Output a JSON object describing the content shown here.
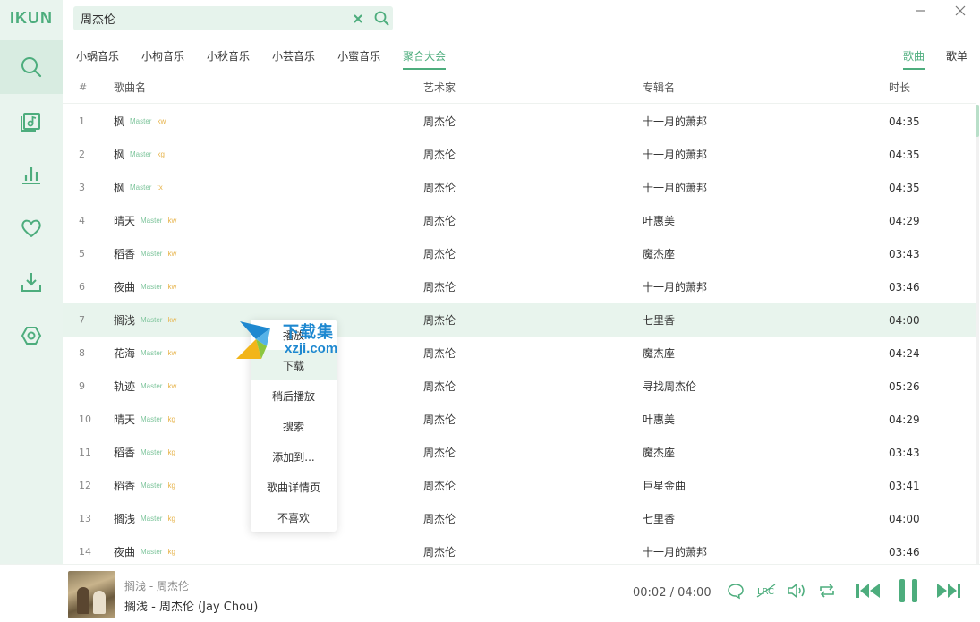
{
  "app": {
    "logo": "IKUN"
  },
  "search": {
    "value": "周杰伦"
  },
  "tabs": [
    {
      "label": "小蜗音乐",
      "active": false
    },
    {
      "label": "小枸音乐",
      "active": false
    },
    {
      "label": "小秋音乐",
      "active": false
    },
    {
      "label": "小芸音乐",
      "active": false
    },
    {
      "label": "小蜜音乐",
      "active": false
    },
    {
      "label": "聚合大会",
      "active": true
    }
  ],
  "type_tabs": [
    {
      "label": "歌曲",
      "active": true
    },
    {
      "label": "歌单",
      "active": false
    }
  ],
  "columns": {
    "idx": "#",
    "name": "歌曲名",
    "artist": "艺术家",
    "album": "专辑名",
    "duration": "时长"
  },
  "rows": [
    {
      "idx": "1",
      "name": "枫",
      "quality": "Master",
      "source": "kw",
      "artist": "周杰伦",
      "album": "十一月的萧邦",
      "duration": "04:35"
    },
    {
      "idx": "2",
      "name": "枫",
      "quality": "Master",
      "source": "kg",
      "artist": "周杰伦",
      "album": "十一月的萧邦",
      "duration": "04:35"
    },
    {
      "idx": "3",
      "name": "枫",
      "quality": "Master",
      "source": "tx",
      "artist": "周杰伦",
      "album": "十一月的萧邦",
      "duration": "04:35"
    },
    {
      "idx": "4",
      "name": "晴天",
      "quality": "Master",
      "source": "kw",
      "artist": "周杰伦",
      "album": "叶惠美",
      "duration": "04:29"
    },
    {
      "idx": "5",
      "name": "稻香",
      "quality": "Master",
      "source": "kw",
      "artist": "周杰伦",
      "album": "魔杰座",
      "duration": "03:43"
    },
    {
      "idx": "6",
      "name": "夜曲",
      "quality": "Master",
      "source": "kw",
      "artist": "周杰伦",
      "album": "十一月的萧邦",
      "duration": "03:46"
    },
    {
      "idx": "7",
      "name": "搁浅",
      "quality": "Master",
      "source": "kw",
      "artist": "周杰伦",
      "album": "七里香",
      "duration": "04:00"
    },
    {
      "idx": "8",
      "name": "花海",
      "quality": "Master",
      "source": "kw",
      "artist": "周杰伦",
      "album": "魔杰座",
      "duration": "04:24"
    },
    {
      "idx": "9",
      "name": "轨迹",
      "quality": "Master",
      "source": "kw",
      "artist": "周杰伦",
      "album": "寻找周杰伦",
      "duration": "05:26"
    },
    {
      "idx": "10",
      "name": "晴天",
      "quality": "Master",
      "source": "kg",
      "artist": "周杰伦",
      "album": "叶惠美",
      "duration": "04:29"
    },
    {
      "idx": "11",
      "name": "稻香",
      "quality": "Master",
      "source": "kg",
      "artist": "周杰伦",
      "album": "魔杰座",
      "duration": "03:43"
    },
    {
      "idx": "12",
      "name": "稻香",
      "quality": "Master",
      "source": "kg",
      "artist": "周杰伦",
      "album": "巨星金曲",
      "duration": "03:41"
    },
    {
      "idx": "13",
      "name": "搁浅",
      "quality": "Master",
      "source": "kg",
      "artist": "周杰伦",
      "album": "七里香",
      "duration": "04:00"
    },
    {
      "idx": "14",
      "name": "夜曲",
      "quality": "Master",
      "source": "kg",
      "artist": "周杰伦",
      "album": "十一月的萧邦",
      "duration": "03:46"
    }
  ],
  "highlighted_row": "7",
  "context_menu": [
    "播放",
    "下载",
    "稍后播放",
    "搜索",
    "添加到...",
    "歌曲详情页",
    "不喜欢"
  ],
  "watermark": {
    "text": "下载集",
    "sub": "xzji.com"
  },
  "player": {
    "subtitle": "搁浅 - 周杰伦",
    "title": "搁浅 - 周杰伦 (Jay Chou)",
    "current": "00:02",
    "total": "04:00"
  },
  "colors": {
    "accent": "#4dad7d",
    "sidebar": "#e9f4ee",
    "row_highlight": "#e8f4ed",
    "source_badge": "#e7b44c"
  }
}
